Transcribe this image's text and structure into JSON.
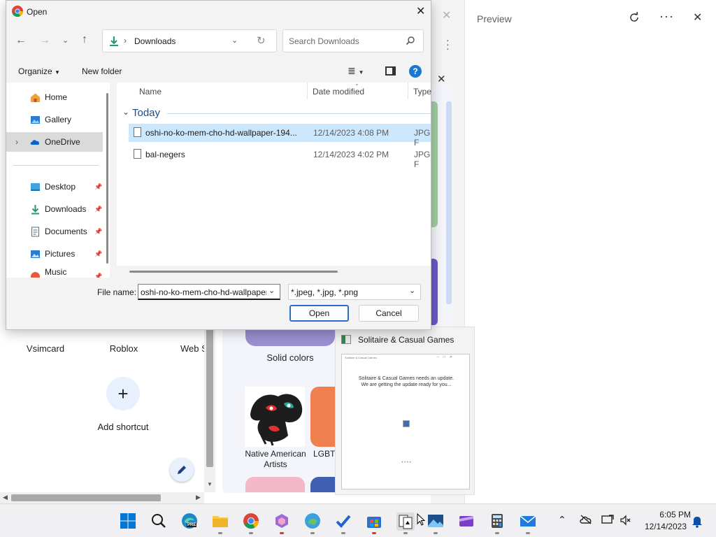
{
  "background_browser": {
    "shortcuts": [
      "Vsimcard",
      "Roblox",
      "Web S"
    ],
    "add_shortcut_label": "Add shortcut",
    "add_shortcut_glyph": "+",
    "gallery": {
      "solid_colors_label": "Solid colors",
      "native_american_label": "Native American Artists",
      "lgbt_label": "LGBTC"
    }
  },
  "preview_panel": {
    "title": "Preview"
  },
  "taskbar_preview": {
    "title": "Solitaire & Casual Games",
    "thumb_title": "Solitaire & Casual Games",
    "thumb_message": "Solitaire & Casual Games needs an update. We are getting the update ready for you...",
    "thumb_dots": "• • • •"
  },
  "dialog": {
    "title": "Open",
    "address": "Downloads",
    "search_placeholder": "Search Downloads",
    "toolbar": {
      "organize_label": "Organize",
      "new_folder_label": "New folder"
    },
    "nav": [
      {
        "label": "Home",
        "pinned": false
      },
      {
        "label": "Gallery",
        "pinned": false
      },
      {
        "label": "OneDrive",
        "pinned": false
      },
      {
        "label": "Desktop",
        "pinned": true
      },
      {
        "label": "Downloads",
        "pinned": true
      },
      {
        "label": "Documents",
        "pinned": true
      },
      {
        "label": "Pictures",
        "pinned": true
      },
      {
        "label": "Music",
        "pinned": true
      }
    ],
    "columns": {
      "name": "Name",
      "date": "Date modified",
      "type": "Type"
    },
    "group_label": "Today",
    "files": [
      {
        "name": "oshi-no-ko-mem-cho-hd-wallpaper-194...",
        "date": "12/14/2023 4:08 PM",
        "type": "JPG F",
        "selected": true
      },
      {
        "name": "bal-negers",
        "date": "12/14/2023 4:02 PM",
        "type": "JPG F",
        "selected": false
      }
    ],
    "file_name_label": "File name:",
    "file_name_value": "oshi-no-ko-mem-cho-hd-wallpaper",
    "file_type_value": "*.jpeg, *.jpg, *.png",
    "open_label": "Open",
    "cancel_label": "Cancel"
  },
  "taskbar": {
    "icons": [
      "windows-start-icon",
      "search-icon",
      "edge-dev-icon",
      "file-explorer-icon",
      "chrome-icon",
      "copilot-icon",
      "weather-icon",
      "todo-icon",
      "store-icon",
      "solitaire-icon",
      "photos-icon",
      "clipchamp-icon",
      "calculator-icon",
      "mail-icon"
    ],
    "edge_badge": "PRE",
    "clock_time": "6:05 PM",
    "clock_date": "12/14/2023"
  },
  "colors": {
    "accent": "#0067c0",
    "selection": "#cce8ff",
    "dialog_bg": "#f3f3f3"
  }
}
